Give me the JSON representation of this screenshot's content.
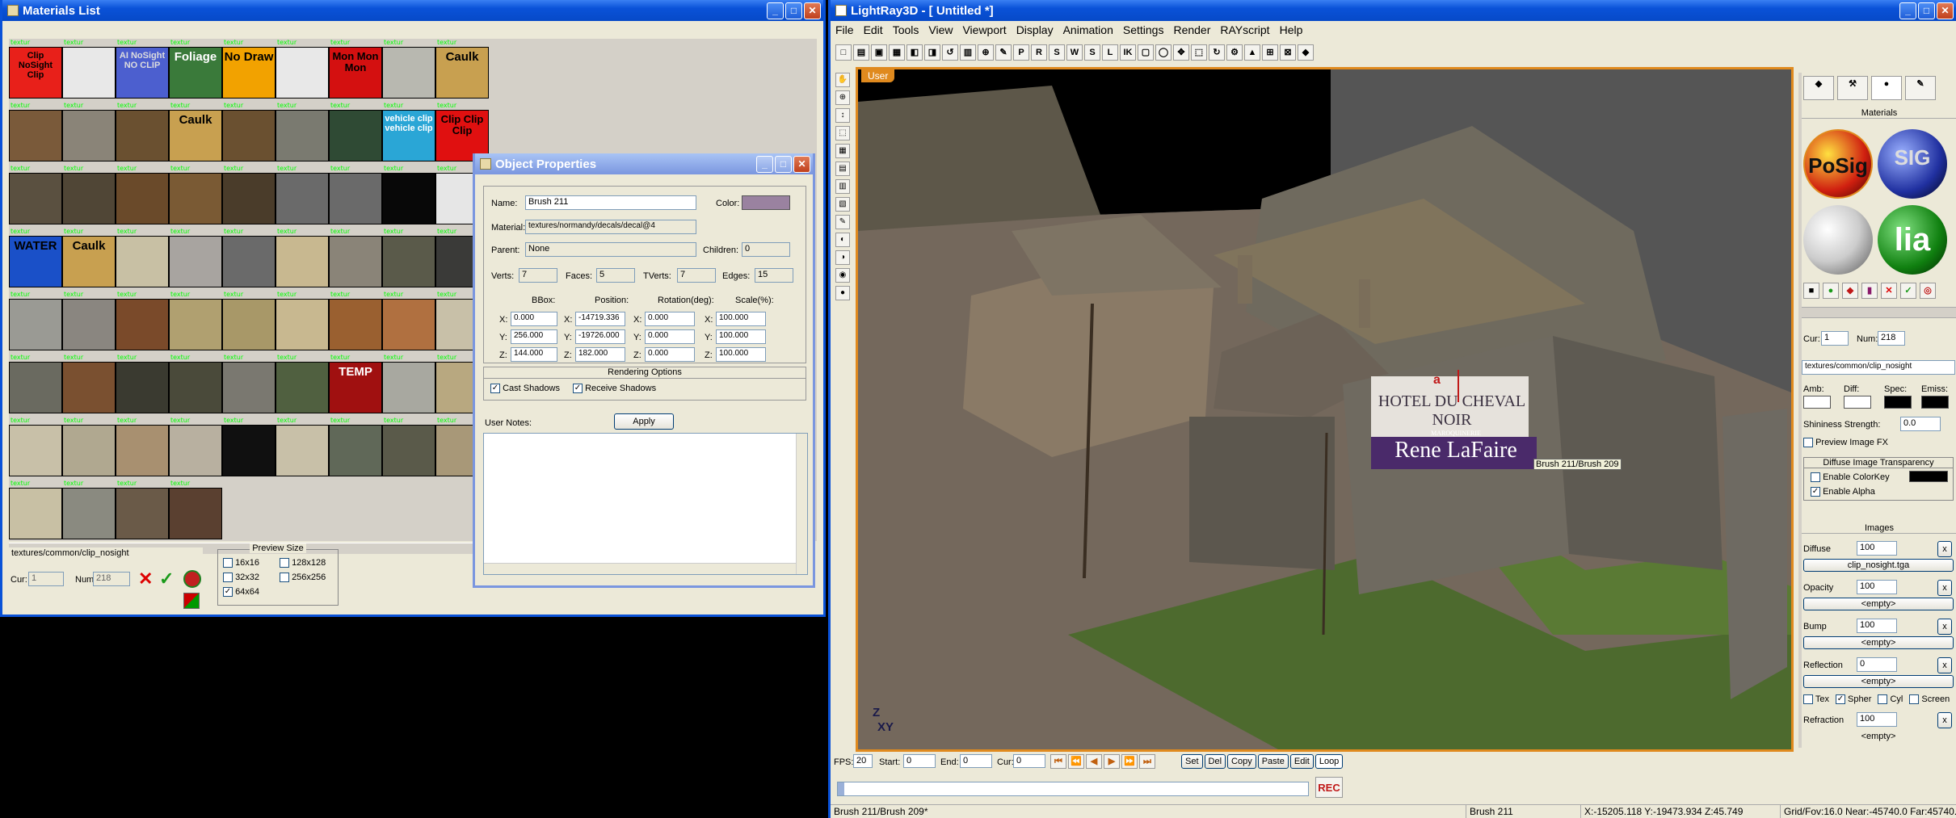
{
  "materials": {
    "title": "Materials List",
    "tile_label": "textur",
    "tiles": [
      {
        "text": "Clip NoSight Clip",
        "bg": "#e8201a",
        "fg": "#000"
      },
      {
        "text": "",
        "bg": "#e8e8e8",
        "fg": "#000"
      },
      {
        "text": "AI NoSight NO CLIP",
        "bg": "#4c5fcf",
        "fg": "#ddd"
      },
      {
        "text": "Foliage",
        "bg": "#3a7a3a",
        "fg": "#fff"
      },
      {
        "text": "No Draw",
        "bg": "#f2a200",
        "fg": "#000"
      },
      {
        "text": "",
        "bg": "#e8e8e8",
        "fg": "#000"
      },
      {
        "text": "Mon Mon Mon",
        "bg": "#d41010",
        "fg": "#000"
      },
      {
        "text": "",
        "bg": "#b8b8b0",
        "fg": "#000"
      },
      {
        "text": "Caulk",
        "bg": "#c8a050",
        "fg": "#000"
      },
      {
        "text": "",
        "bg": "#7a5a3a",
        "fg": "#000"
      },
      {
        "text": "",
        "bg": "#8a8478",
        "fg": "#000"
      },
      {
        "text": "",
        "bg": "#6a5030",
        "fg": "#000"
      },
      {
        "text": "Caulk",
        "bg": "#c8a050",
        "fg": "#000"
      },
      {
        "text": "",
        "bg": "#6a5030",
        "fg": "#000"
      },
      {
        "text": "",
        "bg": "#7a7a70",
        "fg": "#000"
      },
      {
        "text": "",
        "bg": "#2f4a34",
        "fg": "#000"
      },
      {
        "text": "vehicle clip vehicle clip",
        "bg": "#2aa6d6",
        "fg": "#fff"
      },
      {
        "text": "Clip Clip Clip",
        "bg": "#e01010",
        "fg": "#000"
      },
      {
        "text": "",
        "bg": "#5a5040",
        "fg": "#000"
      },
      {
        "text": "",
        "bg": "#504636",
        "fg": "#000"
      },
      {
        "text": "",
        "bg": "#6a4a2a",
        "fg": "#000"
      },
      {
        "text": "",
        "bg": "#7a5a34",
        "fg": "#000"
      },
      {
        "text": "",
        "bg": "#4a3c2a",
        "fg": "#000"
      },
      {
        "text": "",
        "bg": "#6a6a6a",
        "fg": "#000"
      },
      {
        "text": "",
        "bg": "#6a6a6a",
        "fg": "#000"
      },
      {
        "text": "",
        "bg": "#080808",
        "fg": "#000"
      },
      {
        "text": "",
        "bg": "#e6e6e6",
        "fg": "#000"
      },
      {
        "text": "WATER",
        "bg": "#1a50c8",
        "fg": "#000"
      },
      {
        "text": "Caulk",
        "bg": "#c8a050",
        "fg": "#000"
      },
      {
        "text": "",
        "bg": "#c8c0a4",
        "fg": "#000"
      },
      {
        "text": "",
        "bg": "#a8a4a0",
        "fg": "#000"
      },
      {
        "text": "",
        "bg": "#6a6a6a",
        "fg": "#000"
      },
      {
        "text": "",
        "bg": "#c8b890",
        "fg": "#000"
      },
      {
        "text": "",
        "bg": "#8a8478",
        "fg": "#000"
      },
      {
        "text": "",
        "bg": "#5a5a4a",
        "fg": "#000"
      },
      {
        "text": "",
        "bg": "#3a3a38",
        "fg": "#000"
      },
      {
        "text": "",
        "bg": "#9a9a94",
        "fg": "#000"
      },
      {
        "text": "",
        "bg": "#8a8680",
        "fg": "#000"
      },
      {
        "text": "",
        "bg": "#7a4a2a",
        "fg": "#000"
      },
      {
        "text": "",
        "bg": "#b0a070",
        "fg": "#000"
      },
      {
        "text": "",
        "bg": "#a89868",
        "fg": "#000"
      },
      {
        "text": "",
        "bg": "#c8b890",
        "fg": "#000"
      },
      {
        "text": "",
        "bg": "#9a6030",
        "fg": "#000"
      },
      {
        "text": "",
        "bg": "#b07040",
        "fg": "#000"
      },
      {
        "text": "",
        "bg": "#c8c0a8",
        "fg": "#000"
      },
      {
        "text": "",
        "bg": "#6a6a60",
        "fg": "#000"
      },
      {
        "text": "",
        "bg": "#7a5030",
        "fg": "#000"
      },
      {
        "text": "",
        "bg": "#3a3a30",
        "fg": "#000"
      },
      {
        "text": "",
        "bg": "#4a4a3a",
        "fg": "#000"
      },
      {
        "text": "",
        "bg": "#7a7870",
        "fg": "#000"
      },
      {
        "text": "",
        "bg": "#506040",
        "fg": "#000"
      },
      {
        "text": "TEMP",
        "bg": "#a01010",
        "fg": "#fff"
      },
      {
        "text": "",
        "bg": "#a8a8a0",
        "fg": "#000"
      },
      {
        "text": "",
        "bg": "#b8a880",
        "fg": "#000"
      },
      {
        "text": "",
        "bg": "#c8c0a8",
        "fg": "#000"
      },
      {
        "text": "",
        "bg": "#b0a890",
        "fg": "#000"
      },
      {
        "text": "",
        "bg": "#a89070",
        "fg": "#000"
      },
      {
        "text": "",
        "bg": "#b8b0a0",
        "fg": "#000"
      },
      {
        "text": "",
        "bg": "#101010",
        "fg": "#000"
      },
      {
        "text": "",
        "bg": "#c8c0a8",
        "fg": "#000"
      },
      {
        "text": "",
        "bg": "#606858",
        "fg": "#000"
      },
      {
        "text": "",
        "bg": "#5a5a4a",
        "fg": "#000"
      },
      {
        "text": "",
        "bg": "#a89878",
        "fg": "#000"
      },
      {
        "text": "",
        "bg": "#c8c0a4",
        "fg": "#000"
      },
      {
        "text": "",
        "bg": "#8a8a80",
        "fg": "#000"
      },
      {
        "text": "",
        "bg": "#6a5a48",
        "fg": "#000"
      },
      {
        "text": "",
        "bg": "#5a4030",
        "fg": "#000"
      }
    ],
    "path": "textures/common/clip_nosight",
    "cur_label": "Cur:",
    "cur_value": "1",
    "num_label": "Num:",
    "num_value": "218",
    "preview_title": "Preview Size",
    "preview_options": [
      "16x16",
      "128x128",
      "32x32",
      "256x256",
      "64x64"
    ]
  },
  "objprops": {
    "title": "Object Properties",
    "name_label": "Name:",
    "name_value": "Brush 211",
    "color_label": "Color:",
    "color_value": "#9a82a0",
    "material_label": "Material:",
    "material_value": "textures/normandy/decals/decal@4",
    "parent_label": "Parent:",
    "parent_value": "None",
    "children_label": "Children:",
    "children_value": "0",
    "verts_label": "Verts:",
    "verts_value": "7",
    "faces_label": "Faces:",
    "faces_value": "5",
    "tverts_label": "TVerts:",
    "tverts_value": "7",
    "edges_label": "Edges:",
    "edges_value": "15",
    "col_headers": [
      "BBox:",
      "Position:",
      "Rotation(deg):",
      "Scale(%):"
    ],
    "rows": [
      {
        "axis": "X:",
        "bbox": "0.000",
        "pos": "-14719.336",
        "rot": "0.000",
        "scale": "100.000"
      },
      {
        "axis": "Y:",
        "bbox": "256.000",
        "pos": "-19726.000",
        "rot": "0.000",
        "scale": "100.000"
      },
      {
        "axis": "Z:",
        "bbox": "144.000",
        "pos": "182.000",
        "rot": "0.000",
        "scale": "100.000"
      }
    ],
    "rendering_title": "Rendering Options",
    "cast_shadows": "Cast Shadows",
    "receive_shadows": "Receive Shadows",
    "user_notes_label": "User Notes:",
    "apply_label": "Apply"
  },
  "lightray": {
    "title": "LightRay3D - [ Untitled *]",
    "menu": [
      "File",
      "Edit",
      "Tools",
      "View",
      "Viewport",
      "Display",
      "Animation",
      "Settings",
      "Render",
      "RAYscript",
      "Help"
    ],
    "toolbar_letters": [
      "P",
      "R",
      "S",
      "W",
      "S",
      "L",
      "IK"
    ],
    "viewport_label": "User",
    "sign_top": "HOTEL DU CHEVAL NOIR",
    "sign_bottom": "Rene LaFaire",
    "sign_bottom_small": "MAROQUINERIE",
    "selection_tag": "Brush 211/Brush 209",
    "axis_z": "Z",
    "axis_xy": "XY",
    "gizmo_letters": "a",
    "right": {
      "materials_header": "Materials",
      "sphere_labels": [
        "PoSig",
        "SIG",
        "",
        "lia"
      ],
      "cur_label": "Cur:",
      "cur_value": "1",
      "num_label": "Num:",
      "num_value": "218",
      "path": "textures/common/clip_nosight",
      "amb": "Amb:",
      "diff": "Diff:",
      "spec": "Spec:",
      "emiss": "Emiss:",
      "shininess_label": "Shininess Strength:",
      "shininess_value": "0.0",
      "preview_fx": "Preview Image FX",
      "diffuse_transp": "Diffuse Image Transparency",
      "enable_colorkey": "Enable ColorKey",
      "enable_alpha": "Enable Alpha",
      "images_header": "Images",
      "channels": [
        {
          "label": "Diffuse",
          "value": "100",
          "file": "clip_nosight.tga"
        },
        {
          "label": "Opacity",
          "value": "100",
          "file": "<empty>"
        },
        {
          "label": "Bump",
          "value": "100",
          "file": "<empty>"
        },
        {
          "label": "Reflection",
          "value": "0",
          "file": "<empty>"
        }
      ],
      "tex_opts": [
        "Tex",
        "Spher",
        "Cyl",
        "Screen"
      ],
      "refraction_label": "Refraction",
      "refraction_value": "100",
      "refraction_file": "<empty>"
    },
    "timeline": {
      "fps_label": "FPS:",
      "fps_value": "20",
      "start_label": "Start:",
      "start_value": "0",
      "end_label": "End:",
      "end_value": "0",
      "cur_label": "Cur:",
      "cur_value": "0",
      "buttons": [
        "Set",
        "Del",
        "Copy",
        "Paste",
        "Edit",
        "Loop"
      ],
      "rec": "REC"
    },
    "status": {
      "selection": "Brush 211/Brush 209*",
      "object": "Brush 211",
      "coords": "X:-15205.118 Y:-19473.934 Z:45.749",
      "grid": "Grid/Fov:16.0 Near:-45740.0 Far:45740."
    }
  }
}
